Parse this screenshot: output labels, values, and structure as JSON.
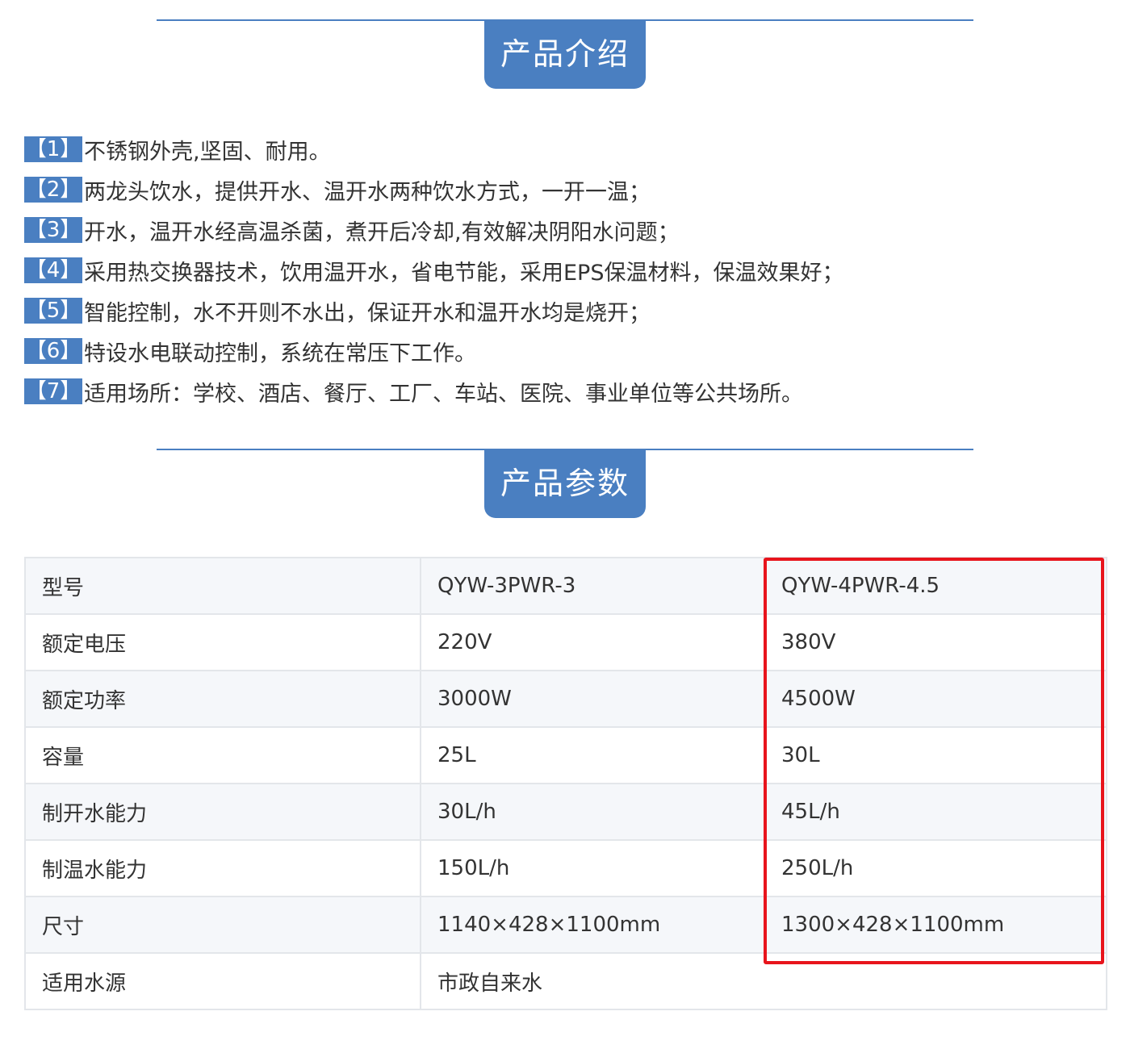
{
  "intro": {
    "title": "产品介绍",
    "features": [
      {
        "num": "【1】",
        "text": "不锈钢外壳,坚固、耐用。"
      },
      {
        "num": "【2】",
        "text": "两龙头饮水，提供开水、温开水两种饮水方式，一开一温；"
      },
      {
        "num": "【3】",
        "text": "开水，温开水经高温杀菌，煮开后冷却,有效解决阴阳水问题；"
      },
      {
        "num": "【4】",
        "text": "采用热交换器技术，饮用温开水，省电节能，采用EPS保温材料，保温效果好；"
      },
      {
        "num": "【5】",
        "text": "智能控制，水不开则不水出，保证开水和温开水均是烧开；"
      },
      {
        "num": "【6】",
        "text": "特设水电联动控制，系统在常压下工作。"
      },
      {
        "num": "【7】",
        "text": "适用场所：学校、酒店、餐厅、工厂、车站、医院、事业单位等公共场所。"
      }
    ]
  },
  "params": {
    "title": "产品参数",
    "rows": [
      {
        "label": "型号",
        "v1": "QYW-3PWR-3",
        "v2": "QYW-4PWR-4.5"
      },
      {
        "label": "额定电压",
        "v1": "220V",
        "v2": "380V"
      },
      {
        "label": "额定功率",
        "v1": "3000W",
        "v2": "4500W"
      },
      {
        "label": "容量",
        "v1": "25L",
        "v2": "30L"
      },
      {
        "label": "制开水能力",
        "v1": "30L/h",
        "v2": "45L/h"
      },
      {
        "label": "制温水能力",
        "v1": "150L/h",
        "v2": "250L/h"
      },
      {
        "label": "尺寸",
        "v1": "1140×428×1100mm",
        "v2": "1300×428×1100mm"
      }
    ],
    "water_source": {
      "label": "适用水源",
      "value": "市政自来水"
    }
  },
  "colors": {
    "accent": "#4a7fc1",
    "highlight": "#e8141c",
    "row_alt": "#f5f7fa",
    "border": "#e3e6ea"
  }
}
